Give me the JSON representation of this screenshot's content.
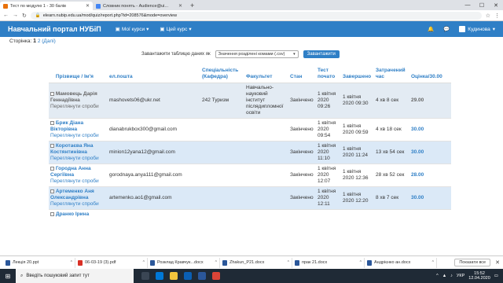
{
  "browser": {
    "tabs": [
      {
        "title": "Тест по модулю 1 - 30 балів",
        "active": true
      },
      {
        "title": "Словник понять - Audience@ui...",
        "active": false
      }
    ],
    "url": "elearn.nubip.edu.ua/mod/quiz/report.php?id=208576&mode=overview"
  },
  "header": {
    "brand": "Навчальний портал НУБіП",
    "menus": [
      "Мої курси",
      "Цей курс"
    ],
    "user": "Кудинова"
  },
  "pager": {
    "label": "Сторінка:",
    "current": "1",
    "page2": "2",
    "next": "(Далі)"
  },
  "download": {
    "label": "Завантажити таблицю даних як",
    "format": "Значення розділені комами (.csv)",
    "button": "Завантажити"
  },
  "table": {
    "headers": [
      "Прізвище / Ім'я",
      "ел.пошта",
      "Спеціальність (Кафедра)",
      "Факультет",
      "Стан",
      "Тест почато",
      "Завершено",
      "Затрачений час",
      "Оцінка/30.00"
    ],
    "rows": [
      {
        "name": "Мамовець Дарія Геннадіївна",
        "review": "Переглянути спроби",
        "email": "mashovets06@ukr.net",
        "spec": "242 Туризм",
        "faculty": "Навчально-науковий інститут післядипломної освіти",
        "state": "Закінчено",
        "started": "1 квітня 2020 09:26",
        "finished": "1 квітня 2020 09:30",
        "time": "4 хв 8 сек",
        "grade": "29.00"
      },
      {
        "name": "Брик Діана Вікторівна",
        "review": "Переглянути спроби",
        "email": "dianabrukbox300@gmail.com",
        "spec": "",
        "faculty": "",
        "state": "Закінчено",
        "started": "1 квітня 2020 09:54",
        "finished": "1 квітня 2020 09:59",
        "time": "4 хв 18 сек",
        "grade": "30.00"
      },
      {
        "name": "Коротаєва Яна Костянтинівна",
        "review": "Переглянути спроби",
        "email": "minion12yana12@gmail.com",
        "spec": "",
        "faculty": "",
        "state": "Закінчено",
        "started": "1 квітня 2020 11:10",
        "finished": "1 квітня 2020 11:24",
        "time": "13 хв 54 сек",
        "grade": "30.00"
      },
      {
        "name": "Городна Анна Сергіївна",
        "review": "Переглянути спроби",
        "email": "gorodnaya.anya111@gmail.com",
        "spec": "",
        "faculty": "",
        "state": "Закінчено",
        "started": "1 квітня 2020 12:07",
        "finished": "1 квітня 2020 12:36",
        "time": "28 хв 52 сек",
        "grade": "28.00"
      },
      {
        "name": "Артеменко Аня Олександрівна",
        "review": "Переглянути спроби",
        "email": "artemenko.ao1@gmail.com",
        "spec": "",
        "faculty": "",
        "state": "Закінчено",
        "started": "1 квітня 2020 12:11",
        "finished": "1 квітня 2020 12:20",
        "time": "8 хв 7 сек",
        "grade": "30.00"
      },
      {
        "name": "Дранко Ірина",
        "review": "",
        "email": "",
        "spec": "",
        "faculty": "",
        "state": "",
        "started": "",
        "finished": "",
        "time": "",
        "grade": ""
      }
    ]
  },
  "downloads": [
    {
      "name": "Лекція 20.ppt",
      "type": "doc"
    },
    {
      "name": "06-03-19 (3).pdf",
      "type": "pdf"
    },
    {
      "name": "Розклад Кравчук...docx",
      "type": "doc"
    },
    {
      "name": "Zhakun_P21.docx",
      "type": "doc"
    },
    {
      "name": "прак 21.docx",
      "type": "doc"
    },
    {
      "name": "Андрієнко ан.docx",
      "type": "doc"
    }
  ],
  "downloads_showall": "Показати все",
  "taskbar": {
    "search": "Введіть пошуковий запит тут",
    "lang": "УКР",
    "time": "15:52",
    "date": "12.04.2020"
  }
}
